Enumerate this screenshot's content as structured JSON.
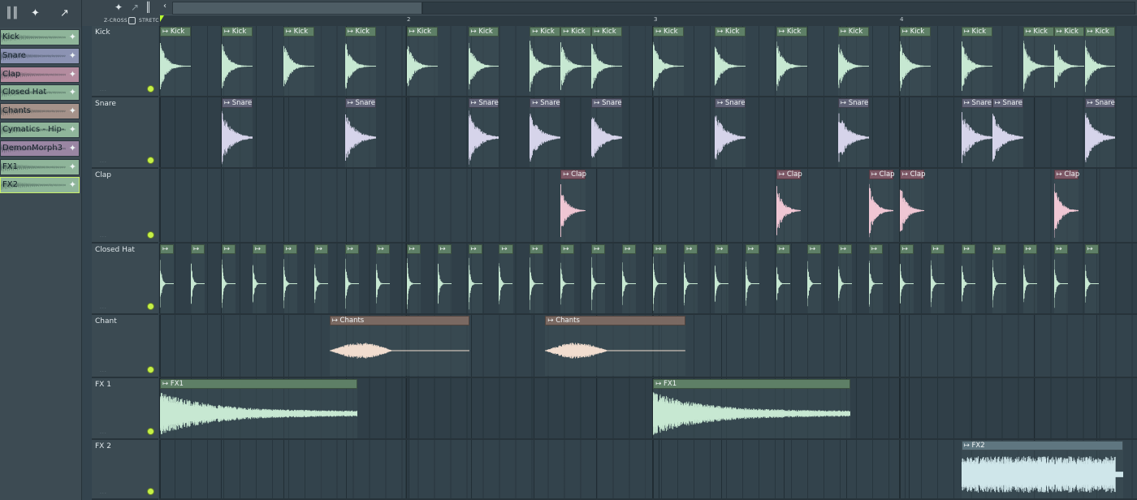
{
  "picker": {
    "items": [
      {
        "label": "Kick",
        "color": "#8fb59a"
      },
      {
        "label": "Snare",
        "color": "#8c93b3"
      },
      {
        "label": "Clap",
        "color": "#b48c9f"
      },
      {
        "label": "Closed Hat",
        "color": "#8fb59a"
      },
      {
        "label": "Chants",
        "color": "#a5928a"
      },
      {
        "label": "Cymatics - Hip-Hop…",
        "color": "#8fb59a"
      },
      {
        "label": "DemonMorph3",
        "color": "#9a86a3"
      },
      {
        "label": "FX1",
        "color": "#8fb59a"
      },
      {
        "label": "FX2",
        "color": "#8fb59a"
      }
    ]
  },
  "toolbar": {
    "zcross_label": "Z-CROSS",
    "stretch_label": "STRETCH",
    "icons": [
      "piano-roll-icon",
      "audio-clip-icon",
      "automation-icon",
      "back-arrow-icon"
    ]
  },
  "ruler": {
    "bars": [
      "2",
      "3",
      "4"
    ]
  },
  "tracks": [
    {
      "name": "Kick",
      "clip_label": "Kick",
      "head_color": "#5e7f66",
      "wave_color": "#c7e8d2",
      "type": "kick"
    },
    {
      "name": "Snare",
      "clip_label": "Snare",
      "head_color": "#5f6276",
      "wave_color": "#d6d4ea",
      "type": "snare"
    },
    {
      "name": "Clap",
      "clip_label": "Clap",
      "head_color": "#7d5866",
      "wave_color": "#efc6d3",
      "type": "clap"
    },
    {
      "name": "Closed Hat",
      "clip_label": "",
      "head_color": "#5e7f66",
      "wave_color": "#c7e8d2",
      "type": "hat"
    },
    {
      "name": "Chant",
      "clip_label": "Chants",
      "head_color": "#7a6962",
      "wave_color": "#f1ddcf",
      "type": "chant"
    },
    {
      "name": "FX 1",
      "clip_label": "FX1",
      "head_color": "#5e7f66",
      "wave_color": "#c7e8d2",
      "type": "fx1"
    },
    {
      "name": "FX 2",
      "clip_label": "FX2",
      "head_color": "#5f7680",
      "wave_color": "#cfe6ea",
      "type": "fx2"
    }
  ],
  "colors": {
    "grid_bg": "#33434c",
    "playhead": "#b8ff30",
    "led": "#c5f046"
  }
}
